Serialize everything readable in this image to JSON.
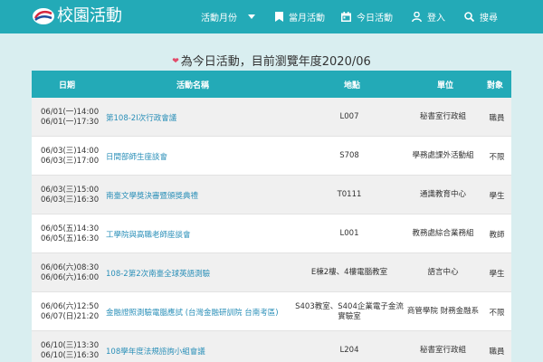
{
  "header": {
    "site_title": "校園活動",
    "nav": {
      "month": "活動月份",
      "current": "當月活動",
      "today": "今日活動",
      "login": "登入",
      "search": "搜尋"
    }
  },
  "heading": "為今日活動，目前瀏覽年度2020/06",
  "table": {
    "columns": [
      "日期",
      "活動名稱",
      "地點",
      "單位",
      "對象"
    ],
    "rows": [
      {
        "start": "06/01(一)14:00",
        "end": "06/01(一)17:30",
        "name": "第108-2I次行政會議",
        "location": "L007",
        "unit": "秘書室行政組",
        "audience": "職員"
      },
      {
        "start": "06/03(三)14:00",
        "end": "06/03(三)17:00",
        "name": "日間部師生座談會",
        "location": "S708",
        "unit": "學務處課外活動組",
        "audience": "不限"
      },
      {
        "start": "06/03(三)15:00",
        "end": "06/03(三)16:30",
        "name": "南臺文學獎決審暨頒獎典禮",
        "location": "T0111",
        "unit": "通識教育中心",
        "audience": "學生"
      },
      {
        "start": "06/05(五)14:30",
        "end": "06/05(五)16:30",
        "name": "工學院與高職老師座談會",
        "location": "L001",
        "unit": "教務處綜合業務組",
        "audience": "教師"
      },
      {
        "start": "06/06(六)08:30",
        "end": "06/06(六)16:00",
        "name": "108-2第2次南臺全球英語測驗",
        "location": "E棟2樓、4樓電腦教室",
        "unit": "語言中心",
        "audience": "學生"
      },
      {
        "start": "06/06(六)12:50",
        "end": "06/07(日)21:20",
        "name": "金融證照測驗電腦應試 (台灣金融研訓院 台南考區)",
        "location": "S403教室、S404企業電子金流實驗室",
        "unit": "商管學院 財務金融系",
        "audience": "不限"
      },
      {
        "start": "06/10(三)13:30",
        "end": "06/10(三)16:30",
        "name": "108學年度法規諮詢小組會議",
        "location": "L204",
        "unit": "秘書室行政組",
        "audience": "職員"
      }
    ]
  },
  "colors": {
    "primary": "#23aab7",
    "link": "#2a8fb8",
    "heart": "#e24b6a"
  },
  "icons": {
    "logo": "logo-icon",
    "month": "chevron-down-icon",
    "current": "bookmark-icon",
    "today": "calendar-icon",
    "login": "user-icon",
    "search": "search-icon"
  }
}
